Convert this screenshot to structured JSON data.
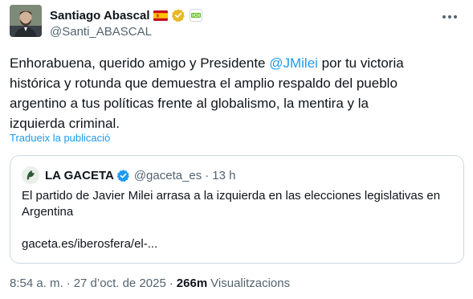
{
  "author": {
    "name": "Santiago Abascal",
    "handle": "@Santi_ABASCAL",
    "flag_icon": "spain-flag-emoji",
    "verified_icon": "gold-verified-badge",
    "affiliation_icon": "vox-party-badge",
    "affiliation_text": "VOX"
  },
  "tweet": {
    "text_before_mention": "Enhorabuena, querido amigo y Presidente ",
    "mention": "@JMilei",
    "text_after_mention": " por tu victoria histórica y rotunda que demuestra el amplio respaldo del pueblo argentino a tus políticas frente al globalismo, la mentira y la izquierda criminal.",
    "translate_label": "Tradueix la publicació"
  },
  "quote": {
    "name": "LA GACETA",
    "handle": "@gaceta_es",
    "separator": "·",
    "time": "13 h",
    "text": "El partido de Javier Milei arrasa a la izquierda en las elecciones legislativas en Argentina",
    "link": "gaceta.es/iberosfera/el-..."
  },
  "meta": {
    "time": "8:54 a. m.",
    "separator1": "·",
    "date": "27 d’oct. de 2025",
    "separator2": "·",
    "views_count": "266m",
    "views_label": "Visualitzacions"
  },
  "colors": {
    "link": "#1d9bf0",
    "text": "#0f1419",
    "secondary": "#536471",
    "border": "#cfd9de",
    "gold_badge": "#e8b829",
    "blue_badge": "#1d9bf0"
  }
}
